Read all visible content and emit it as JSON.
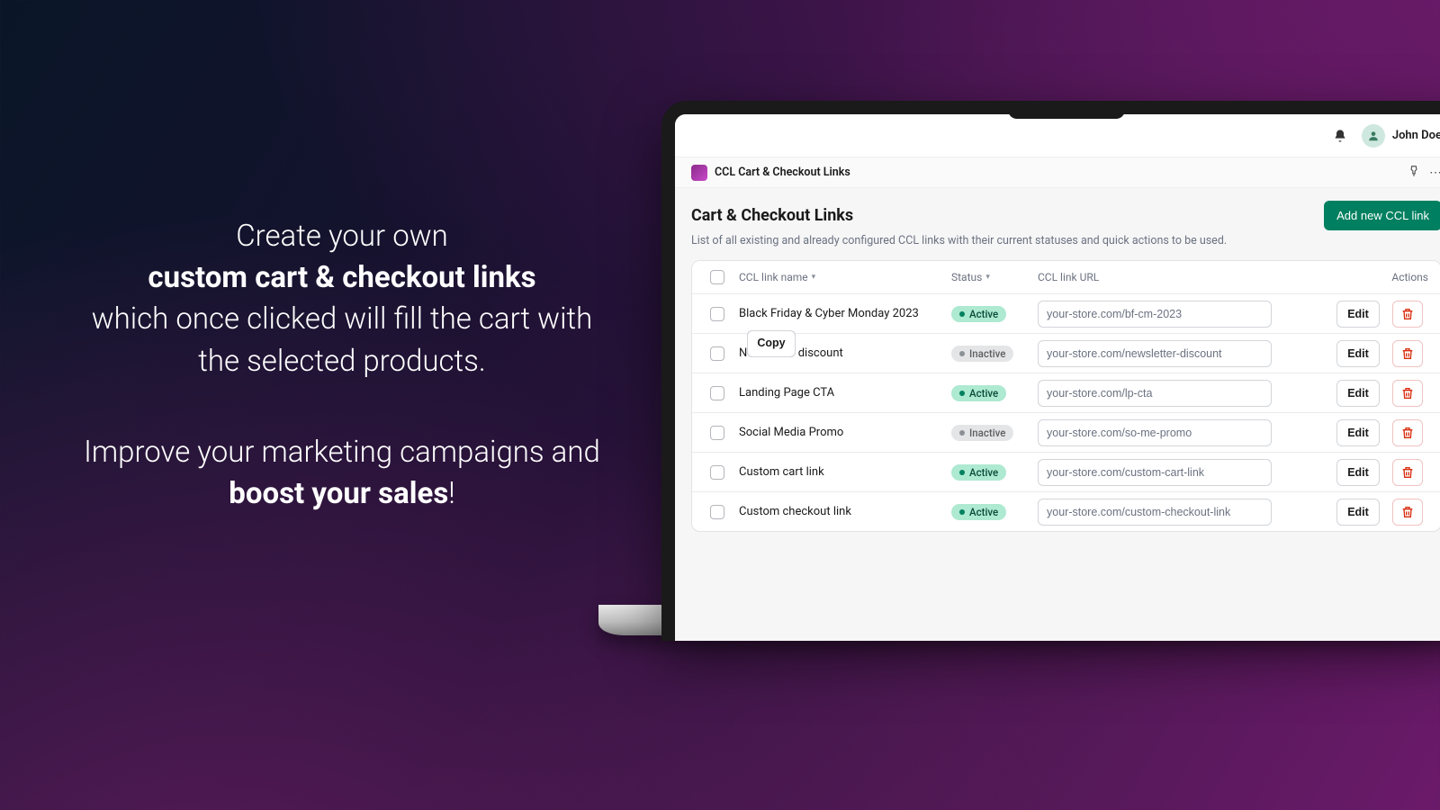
{
  "marketing": {
    "p1_a": "Create your own",
    "p1_b": "custom cart & checkout links",
    "p1_c": "which once clicked will fill the cart with the selected products.",
    "p2_a": "Improve your marketing campaigns and ",
    "p2_b": "boost your sales",
    "p2_c": "!"
  },
  "topbar": {
    "user_name": "John Doe"
  },
  "app_header": {
    "app_name": "CCL Cart & Checkout Links"
  },
  "page": {
    "title": "Cart & Checkout Links",
    "subtitle": "List of all existing and already configured CCL links with their current statuses and quick actions to be used.",
    "add_button": "Add new CCL link"
  },
  "table": {
    "columns": {
      "name": "CCL link name",
      "status": "Status",
      "url": "CCL link URL",
      "actions": "Actions"
    },
    "copy_label": "Copy",
    "edit_label": "Edit",
    "status_active": "Active",
    "status_inactive": "Inactive",
    "rows": [
      {
        "name": "Black Friday & Cyber Monday 2023",
        "status": "active",
        "url": "your-store.com/bf-cm-2023"
      },
      {
        "name": "Newsletter discount",
        "status": "inactive",
        "url": "your-store.com/newsletter-discount"
      },
      {
        "name": "Landing Page CTA",
        "status": "active",
        "url": "your-store.com/lp-cta"
      },
      {
        "name": "Social Media Promo",
        "status": "inactive",
        "url": "your-store.com/so-me-promo"
      },
      {
        "name": "Custom cart link",
        "status": "active",
        "url": "your-store.com/custom-cart-link"
      },
      {
        "name": "Custom checkout link",
        "status": "active",
        "url": "your-store.com/custom-checkout-link"
      }
    ]
  }
}
